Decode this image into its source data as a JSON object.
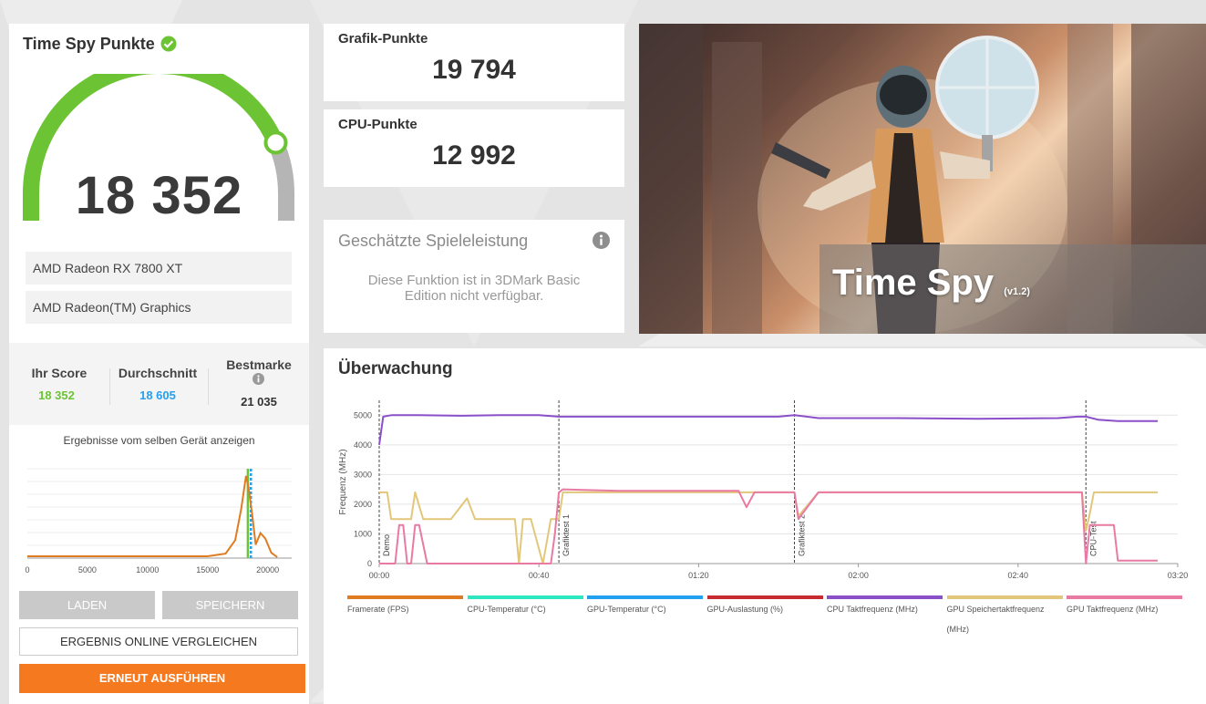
{
  "score_panel": {
    "title": "Time Spy Punkte",
    "score": "18 352",
    "gauge_fraction": 0.87,
    "devices": [
      "AMD Radeon RX 7800 XT",
      "AMD Radeon(TM) Graphics"
    ],
    "your_score_label": "Ihr Score",
    "your_score_value": "18 352",
    "average_label": "Durchschnitt",
    "average_value": "18 605",
    "best_label": "Bestmarke",
    "best_value": "21 035",
    "same_device_label": "Ergebnisse vom selben Gerät anzeigen",
    "btn_load": "LADEN",
    "btn_save": "SPEICHERN",
    "btn_compare": "ERGEBNIS ONLINE VERGLEICHEN",
    "btn_rerun": "ERNEUT AUSFÜHREN"
  },
  "distribution_chart": {
    "x_ticks": [
      "0",
      "5000",
      "10000",
      "15000",
      "20000"
    ],
    "x_min": 0,
    "x_max": 22000,
    "points": [
      [
        0,
        0.02
      ],
      [
        15000,
        0.02
      ],
      [
        16500,
        0.05
      ],
      [
        17300,
        0.2
      ],
      [
        17800,
        0.55
      ],
      [
        18200,
        0.92
      ],
      [
        18400,
        0.8
      ],
      [
        18700,
        0.5
      ],
      [
        19000,
        0.15
      ],
      [
        19400,
        0.28
      ],
      [
        19800,
        0.22
      ],
      [
        20300,
        0.06
      ],
      [
        20800,
        0.01
      ]
    ],
    "your_score": 18352,
    "average": 18605
  },
  "graphics_score": {
    "label": "Grafik-Punkte",
    "value": "19 794"
  },
  "cpu_score": {
    "label": "CPU-Punkte",
    "value": "12 992"
  },
  "estimated": {
    "title": "Geschätzte Spieleleistung",
    "message": "Diese Funktion ist in 3DMark Basic Edition nicht verfügbar."
  },
  "hero": {
    "title": "Time Spy",
    "version": "(v1.2)"
  },
  "monitoring": {
    "title": "Überwachung",
    "y_axis_label": "Frequenz (MHz)",
    "y_ticks": [
      "0",
      "1000",
      "2000",
      "3000",
      "4000",
      "5000"
    ],
    "x_ticks": [
      "00:00",
      "00:40",
      "01:20",
      "02:00",
      "02:40",
      "03:20"
    ],
    "markers": [
      "Demo",
      "Grafiktest 1",
      "Grafiktest 2",
      "CPU-Test"
    ],
    "legend": [
      {
        "label": "Framerate (FPS)",
        "color": "#e07b22"
      },
      {
        "label": "CPU-Temperatur (°C)",
        "color": "#2ee6c0"
      },
      {
        "label": "GPU-Temperatur (°C)",
        "color": "#23a0ef"
      },
      {
        "label": "GPU-Auslastung (%)",
        "color": "#c62b32"
      },
      {
        "label": "CPU Taktfrequenz (MHz)",
        "color": "#8a4fc9"
      },
      {
        "label": "GPU Speichertaktfrequenz (MHz)",
        "color": "#e2c77a"
      },
      {
        "label": "GPU Taktfrequenz (MHz)",
        "color": "#e87aa3"
      }
    ]
  },
  "chart_data": {
    "type": "line",
    "title": "Überwachung",
    "xlabel": "",
    "ylabel": "Frequenz (MHz)",
    "x_range_seconds": [
      0,
      200
    ],
    "ylim": [
      0,
      5500
    ],
    "x_tick_labels": [
      "00:00",
      "00:40",
      "01:20",
      "02:00",
      "02:40",
      "03:20"
    ],
    "y_tick_labels": [
      "0",
      "1000",
      "2000",
      "3000",
      "4000",
      "5000"
    ],
    "markers": [
      {
        "label": "Demo",
        "x": 0
      },
      {
        "label": "Grafiktest 1",
        "x": 45
      },
      {
        "label": "Grafiktest 2",
        "x": 104
      },
      {
        "label": "CPU-Test",
        "x": 177
      }
    ],
    "series": [
      {
        "name": "CPU Taktfrequenz (MHz)",
        "color": "#8a4fc9",
        "x": [
          0,
          1,
          3,
          10,
          20,
          30,
          40,
          45,
          60,
          80,
          100,
          104,
          110,
          130,
          150,
          170,
          175,
          177,
          180,
          185,
          195
        ],
        "y": [
          4000,
          4950,
          5000,
          5000,
          4980,
          5000,
          5000,
          4950,
          4950,
          4950,
          4950,
          5000,
          4900,
          4900,
          4880,
          4900,
          4950,
          4950,
          4850,
          4800,
          4800
        ]
      },
      {
        "name": "GPU Speichertaktfrequenz (MHz)",
        "color": "#e2c77a",
        "x": [
          0,
          2,
          3,
          8,
          9,
          11,
          18,
          22,
          24,
          26,
          26.5,
          30,
          34,
          35,
          36,
          38,
          39,
          41,
          43,
          45,
          46,
          60,
          90,
          104,
          105,
          110,
          150,
          176,
          177,
          178,
          179,
          195
        ],
        "y": [
          2400,
          2400,
          1500,
          1500,
          2400,
          1500,
          1500,
          2200,
          1500,
          1500,
          1500,
          1500,
          1500,
          0,
          1500,
          1500,
          1000,
          0,
          1500,
          1500,
          2400,
          2400,
          2400,
          2400,
          1600,
          2400,
          2400,
          2400,
          1100,
          1700,
          2400,
          2400
        ]
      },
      {
        "name": "GPU Taktfrequenz (MHz)",
        "color": "#e87aa3",
        "x": [
          0,
          2,
          4,
          5,
          6,
          7,
          8,
          9,
          10,
          12,
          14,
          20,
          30,
          40,
          43,
          44,
          45,
          46,
          60,
          90,
          92,
          94,
          100,
          104,
          105,
          110,
          150,
          176,
          177,
          178,
          179,
          181,
          184,
          185,
          186,
          195
        ],
        "y": [
          0,
          0,
          0,
          1300,
          1300,
          0,
          0,
          1300,
          1300,
          0,
          0,
          0,
          0,
          0,
          0,
          1000,
          2400,
          2500,
          2450,
          2450,
          1900,
          2400,
          2400,
          2400,
          1500,
          2400,
          2400,
          2400,
          0,
          1300,
          1300,
          1300,
          1300,
          100,
          100,
          100
        ]
      }
    ]
  }
}
